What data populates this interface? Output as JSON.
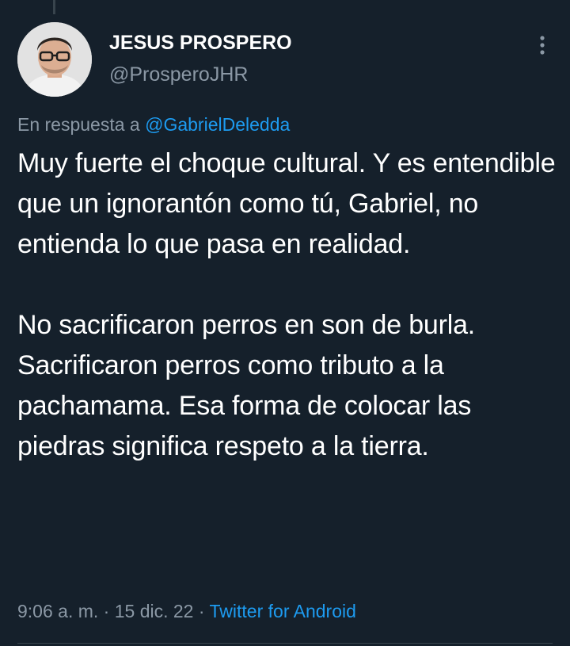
{
  "author": {
    "display_name": "JESUS PROSPERO",
    "handle": "@ProsperoJHR"
  },
  "reply": {
    "prefix": "En respuesta a",
    "mention": "@GabrielDeledda"
  },
  "tweet": {
    "paragraph1": "Muy fuerte el choque cultural. Y es entendible que un ignorantón como tú, Gabriel, no entienda lo que pasa en realidad.",
    "paragraph2_line1": "No sacrificaron perros en son de burla.",
    "paragraph2_line2": "Sacrificaron perros como tributo a la pachamama. Esa forma de colocar las piedras significa respeto a la tierra."
  },
  "meta": {
    "time": "9:06 a. m.",
    "separator": "·",
    "date": "15 dic. 22",
    "source": "Twitter for Android"
  },
  "icons": {
    "more": "more-vertical-icon",
    "avatar": "avatar-photo"
  },
  "colors": {
    "background": "#15202b",
    "text_primary": "#ffffff",
    "text_secondary": "#8b98a5",
    "accent": "#1d9bf0",
    "divider": "#38444d"
  }
}
